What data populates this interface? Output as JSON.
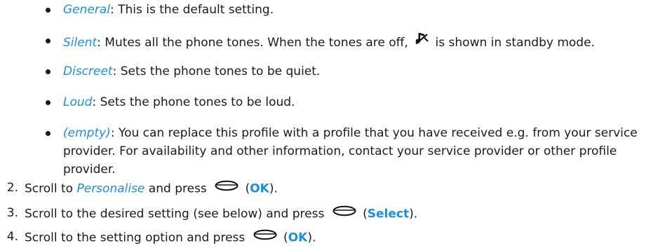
{
  "profiles": [
    {
      "name": "General",
      "sep": ": ",
      "desc": "This is the default setting."
    },
    {
      "name": "Silent",
      "sep": ": ",
      "desc_a": "Mutes all the phone tones. When the tones are off, ",
      "icon": "silent-mode-icon",
      "desc_b": " is shown in standby mode."
    },
    {
      "name": "Discreet",
      "sep": ": ",
      "desc": "Sets the phone tones to be quiet."
    },
    {
      "name": "Loud",
      "sep": ": ",
      "desc": "Sets the phone tones to be loud."
    },
    {
      "name": "(empty)",
      "sep": ": ",
      "desc": "You can replace this profile with a profile that you have received e.g. from your service provider. For availability and other information, contact your service provider or other profile provider."
    }
  ],
  "steps": [
    {
      "num": "2.",
      "pre": "Scroll to ",
      "italic": "Personalise",
      "mid": " and press ",
      "key_icon": "selection-key-icon",
      "open": " (",
      "key_label": "OK",
      "close": ")."
    },
    {
      "num": "3.",
      "pre": "Scroll to the desired setting (see below) and press ",
      "key_icon": "selection-key-icon",
      "open": " (",
      "key_label": "Select",
      "close": ")."
    },
    {
      "num": "4.",
      "pre": "Scroll to the setting option and press ",
      "key_icon": "selection-key-icon",
      "open": " (",
      "key_label": "OK",
      "close": ")."
    }
  ],
  "colors": {
    "accent": "#1a8fe0",
    "text": "#1a1a1a"
  }
}
